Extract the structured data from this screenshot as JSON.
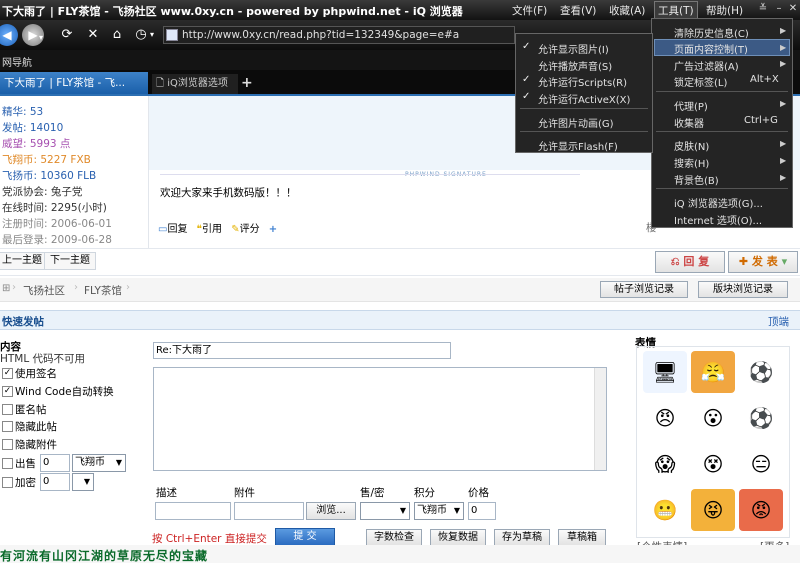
{
  "window": {
    "title": "下大雨了 | FLY茶馆 - 飞扬社区 www.0xy.cn - powered by phpwind.net - iQ 浏览器",
    "menus": [
      "文件(F)",
      "查看(V)",
      "收藏(A)",
      "工具(T)",
      "帮助(H)"
    ]
  },
  "nav": {
    "url": "http://www.0xy.cn/read.php?tid=132349&page=e#a"
  },
  "bookmarks": {
    "item": "网导航"
  },
  "tabs": [
    {
      "label": "下大雨了 | FLY茶馆 - 飞..."
    },
    {
      "label": "iQ浏览器选项"
    }
  ],
  "profile": {
    "rows": [
      "精华: 53",
      "发帖: 14010",
      "威望: 5993 点",
      "飞翔币: 5227 FXB",
      "飞扬币: 10360 FLB",
      "党派协会: 兔子党",
      "在线时间: 2295(小时)",
      "注册时间: 2006-06-01",
      "最后登录: 2009-06-28"
    ]
  },
  "post": {
    "text": "欢迎大家来手机数码版！！！",
    "signature": "PHPWIND SIGNATURE",
    "actions": [
      "回复",
      "引用",
      "评分",
      "+"
    ],
    "right_actions": [
      "楼"
    ]
  },
  "pager": {
    "prev": "上一主题",
    "next": "下一主题",
    "reply": "回 复",
    "new": "发 表"
  },
  "breadcrumb": {
    "items": [
      "飞扬社区",
      "FLY茶馆"
    ],
    "record1": "帖子浏览记录",
    "record2": "版块浏览记录"
  },
  "quick": {
    "title": "快速发帖",
    "top": "顶端",
    "content": "内容",
    "html_note": "HTML 代码不可用",
    "options": [
      {
        "label": "使用签名",
        "checked": true
      },
      {
        "label": "Wind Code自动转换",
        "checked": true
      },
      {
        "label": "匿名帖",
        "checked": false
      },
      {
        "label": "隐藏此帖",
        "checked": false
      },
      {
        "label": "隐藏附件",
        "checked": false
      }
    ],
    "sell": "出售",
    "sell_value": "0",
    "sell_currency": "飞翔币",
    "encrypt": "加密",
    "encrypt_value": "0",
    "subject": "Re:下大雨了",
    "field_desc": "描述",
    "field_attach": "附件",
    "field_sell": "售/密",
    "field_points": "积分",
    "field_price": "价格",
    "browse": "浏览...",
    "points_currency": "飞翔币",
    "price_value": "0",
    "hint": "按 Ctrl+Enter 直接提交",
    "submit": "提 交",
    "buttons": [
      "字数检查",
      "恢复数据",
      "存为草稿",
      "草稿箱"
    ],
    "emoticons_title": "表情",
    "emoticons_personal": "[个性表情]",
    "emoticons_more": "[更多]"
  },
  "footer": {
    "marquee": "有河流有山冈江湖的草原无尽的宝藏"
  },
  "tools_menu": {
    "items": [
      "清除历史信息(C)",
      "页面内容控制(T)",
      "广告过滤器(A)",
      "锁定标签(L)",
      "代理(P)",
      "收集器",
      "皮肤(N)",
      "搜索(H)",
      "背景色(B)",
      "iQ 浏览器选项(G)...",
      "Internet 选项(O)..."
    ],
    "shortcuts": {
      "lock": "Alt+X",
      "collector": "Ctrl+G"
    }
  },
  "content_menu": {
    "items": [
      {
        "label": "允许显示图片(I)",
        "checked": true
      },
      {
        "label": "允许播放声音(S)",
        "checked": false
      },
      {
        "label": "允许运行Scripts(R)",
        "checked": true
      },
      {
        "label": "允许运行ActiveX(X)",
        "checked": true
      },
      {
        "label": "允许图片动画(G)",
        "checked": false
      },
      {
        "label": "允许显示Flash(F)",
        "checked": false
      }
    ]
  }
}
